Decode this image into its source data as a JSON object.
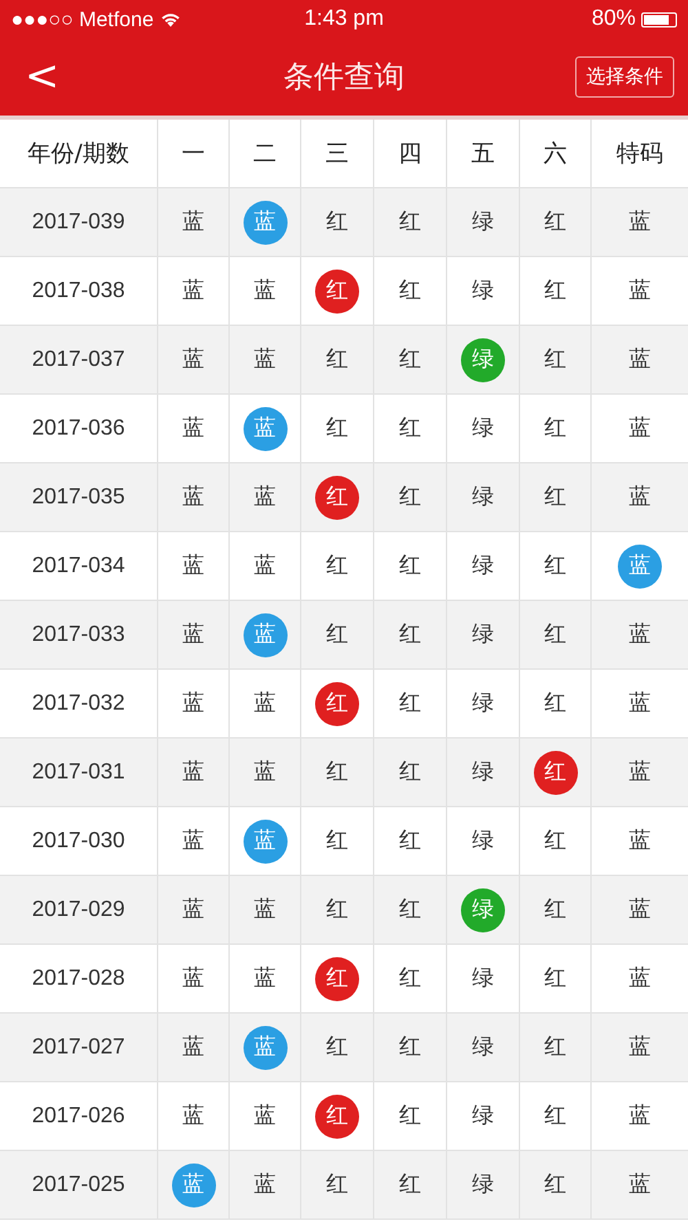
{
  "status_bar": {
    "carrier": "●●●○○ Metfone",
    "time": "1:43 pm",
    "battery": "80%"
  },
  "nav": {
    "back": "<",
    "title": "条件查询",
    "action": "选择条件"
  },
  "table": {
    "period_column": "年份/期数",
    "columns": [
      "一",
      "二",
      "三",
      "四",
      "五",
      "六",
      "特码"
    ],
    "rows": [
      {
        "period": "2017-039",
        "cells": [
          {
            "text": "蓝",
            "circled": false
          },
          {
            "text": "蓝",
            "circled": true,
            "color": "#2b9fe3"
          },
          {
            "text": "红",
            "circled": false
          },
          {
            "text": "红",
            "circled": false
          },
          {
            "text": "绿",
            "circled": false
          },
          {
            "text": "红",
            "circled": false
          },
          {
            "text": "蓝",
            "circled": false
          }
        ]
      },
      {
        "period": "2017-038",
        "cells": [
          {
            "text": "蓝",
            "circled": false
          },
          {
            "text": "蓝",
            "circled": false
          },
          {
            "text": "红",
            "circled": true,
            "color": "#e02020"
          },
          {
            "text": "红",
            "circled": false
          },
          {
            "text": "绿",
            "circled": false
          },
          {
            "text": "红",
            "circled": false
          },
          {
            "text": "蓝",
            "circled": false
          }
        ]
      },
      {
        "period": "2017-037",
        "cells": [
          {
            "text": "蓝",
            "circled": false
          },
          {
            "text": "蓝",
            "circled": false
          },
          {
            "text": "红",
            "circled": false
          },
          {
            "text": "红",
            "circled": false
          },
          {
            "text": "绿",
            "circled": true,
            "color": "#22aa2a"
          },
          {
            "text": "红",
            "circled": false
          },
          {
            "text": "蓝",
            "circled": false
          }
        ]
      },
      {
        "period": "2017-036",
        "cells": [
          {
            "text": "蓝",
            "circled": false
          },
          {
            "text": "蓝",
            "circled": true,
            "color": "#2b9fe3"
          },
          {
            "text": "红",
            "circled": false
          },
          {
            "text": "红",
            "circled": false
          },
          {
            "text": "绿",
            "circled": false
          },
          {
            "text": "红",
            "circled": false
          },
          {
            "text": "蓝",
            "circled": false
          }
        ]
      },
      {
        "period": "2017-035",
        "cells": [
          {
            "text": "蓝",
            "circled": false
          },
          {
            "text": "蓝",
            "circled": false
          },
          {
            "text": "红",
            "circled": true,
            "color": "#e02020"
          },
          {
            "text": "红",
            "circled": false
          },
          {
            "text": "绿",
            "circled": false
          },
          {
            "text": "红",
            "circled": false
          },
          {
            "text": "蓝",
            "circled": false
          }
        ]
      },
      {
        "period": "2017-034",
        "cells": [
          {
            "text": "蓝",
            "circled": false
          },
          {
            "text": "蓝",
            "circled": false
          },
          {
            "text": "红",
            "circled": false
          },
          {
            "text": "红",
            "circled": false
          },
          {
            "text": "绿",
            "circled": false
          },
          {
            "text": "红",
            "circled": false
          },
          {
            "text": "蓝",
            "circled": true,
            "color": "#2b9fe3"
          }
        ]
      },
      {
        "period": "2017-033",
        "cells": [
          {
            "text": "蓝",
            "circled": false
          },
          {
            "text": "蓝",
            "circled": true,
            "color": "#2b9fe3"
          },
          {
            "text": "红",
            "circled": false
          },
          {
            "text": "红",
            "circled": false
          },
          {
            "text": "绿",
            "circled": false
          },
          {
            "text": "红",
            "circled": false
          },
          {
            "text": "蓝",
            "circled": false
          }
        ]
      },
      {
        "period": "2017-032",
        "cells": [
          {
            "text": "蓝",
            "circled": false
          },
          {
            "text": "蓝",
            "circled": false
          },
          {
            "text": "红",
            "circled": true,
            "color": "#e02020"
          },
          {
            "text": "红",
            "circled": false
          },
          {
            "text": "绿",
            "circled": false
          },
          {
            "text": "红",
            "circled": false
          },
          {
            "text": "蓝",
            "circled": false
          }
        ]
      },
      {
        "period": "2017-031",
        "cells": [
          {
            "text": "蓝",
            "circled": false
          },
          {
            "text": "蓝",
            "circled": false
          },
          {
            "text": "红",
            "circled": false
          },
          {
            "text": "红",
            "circled": false
          },
          {
            "text": "绿",
            "circled": false
          },
          {
            "text": "红",
            "circled": true,
            "color": "#e02020"
          },
          {
            "text": "蓝",
            "circled": false
          }
        ]
      },
      {
        "period": "2017-030",
        "cells": [
          {
            "text": "蓝",
            "circled": false
          },
          {
            "text": "蓝",
            "circled": true,
            "color": "#2b9fe3"
          },
          {
            "text": "红",
            "circled": false
          },
          {
            "text": "红",
            "circled": false
          },
          {
            "text": "绿",
            "circled": false
          },
          {
            "text": "红",
            "circled": false
          },
          {
            "text": "蓝",
            "circled": false
          }
        ]
      },
      {
        "period": "2017-029",
        "cells": [
          {
            "text": "蓝",
            "circled": false
          },
          {
            "text": "蓝",
            "circled": false
          },
          {
            "text": "红",
            "circled": false
          },
          {
            "text": "红",
            "circled": false
          },
          {
            "text": "绿",
            "circled": true,
            "color": "#22aa2a"
          },
          {
            "text": "红",
            "circled": false
          },
          {
            "text": "蓝",
            "circled": false
          }
        ]
      },
      {
        "period": "2017-028",
        "cells": [
          {
            "text": "蓝",
            "circled": false
          },
          {
            "text": "蓝",
            "circled": false
          },
          {
            "text": "红",
            "circled": true,
            "color": "#e02020"
          },
          {
            "text": "红",
            "circled": false
          },
          {
            "text": "绿",
            "circled": false
          },
          {
            "text": "红",
            "circled": false
          },
          {
            "text": "蓝",
            "circled": false
          }
        ]
      },
      {
        "period": "2017-027",
        "cells": [
          {
            "text": "蓝",
            "circled": false
          },
          {
            "text": "蓝",
            "circled": true,
            "color": "#2b9fe3"
          },
          {
            "text": "红",
            "circled": false
          },
          {
            "text": "红",
            "circled": false
          },
          {
            "text": "绿",
            "circled": false
          },
          {
            "text": "红",
            "circled": false
          },
          {
            "text": "蓝",
            "circled": false
          }
        ]
      },
      {
        "period": "2017-026",
        "cells": [
          {
            "text": "蓝",
            "circled": false
          },
          {
            "text": "蓝",
            "circled": false
          },
          {
            "text": "红",
            "circled": true,
            "color": "#e02020"
          },
          {
            "text": "红",
            "circled": false
          },
          {
            "text": "绿",
            "circled": false
          },
          {
            "text": "红",
            "circled": false
          },
          {
            "text": "蓝",
            "circled": false
          }
        ]
      },
      {
        "period": "2017-025",
        "cells": [
          {
            "text": "蓝",
            "circled": true,
            "color": "#2b9fe3"
          },
          {
            "text": "蓝",
            "circled": false
          },
          {
            "text": "红",
            "circled": false
          },
          {
            "text": "红",
            "circled": false
          },
          {
            "text": "绿",
            "circled": false
          },
          {
            "text": "红",
            "circled": false
          },
          {
            "text": "蓝",
            "circled": false
          }
        ]
      }
    ]
  }
}
